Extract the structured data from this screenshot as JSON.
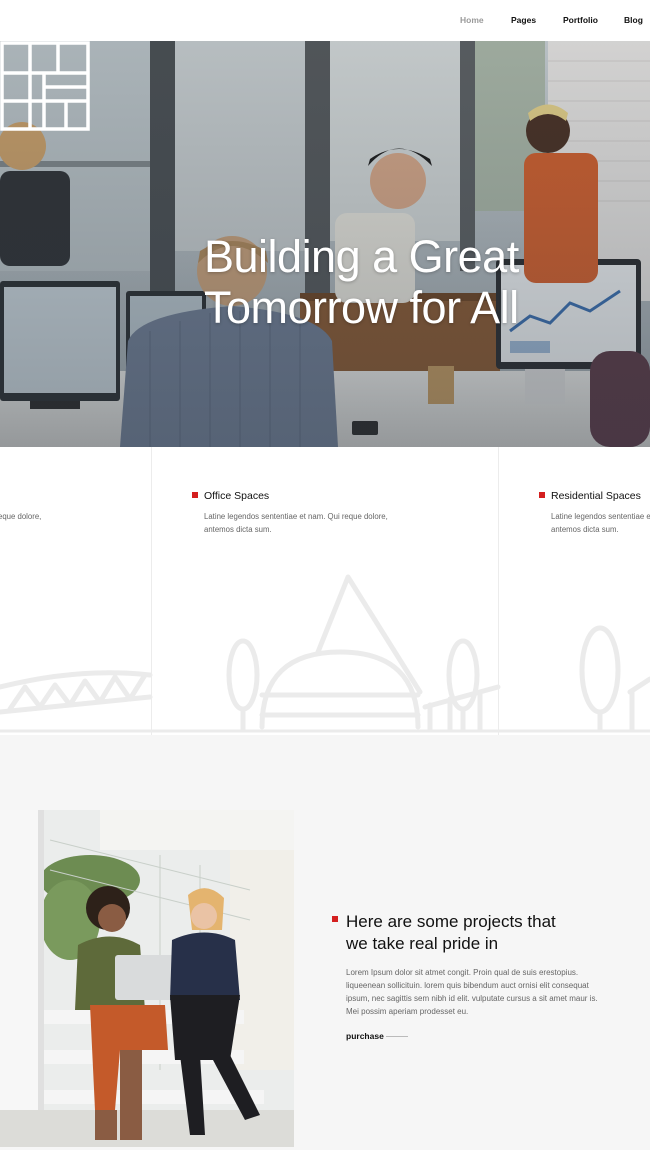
{
  "nav": {
    "items": [
      {
        "label": "Home",
        "active": true
      },
      {
        "label": "Pages",
        "active": false
      },
      {
        "label": "Portfolio",
        "active": false
      },
      {
        "label": "Blog",
        "active": false
      }
    ]
  },
  "hero": {
    "title_line1": "Building a Great",
    "title_line2": "Tomorrow for All"
  },
  "services": [
    {
      "title": "",
      "text_line1": "eque dolore,",
      "text_line2": ""
    },
    {
      "title": "Office Spaces",
      "text_line1": "Latine legendos sententiae et nam. Qui reque dolore,",
      "text_line2": "antemos dicta sum."
    },
    {
      "title": "Residential Spaces",
      "text_line1": "Latine legendos sententiae e",
      "text_line2": "antemos dicta sum."
    }
  ],
  "projects": {
    "title_line1": "Here are some projects that",
    "title_line2": "we take real pride in",
    "text_lines": [
      "Lorem Ipsum dolor sit atmet congit. Proin qual de suis erestopius.",
      "liqueenean sollicituin. lorem quis bibendum auct ornisi elit consequat",
      "ipsum, nec sagittis sem nibh id elit. vulputate cursus a sit amet maur is.",
      "Mei possim aperiam prodesset eu."
    ],
    "link_label": "purchase"
  },
  "colors": {
    "accent": "#d41f1f",
    "background": "#f6f6f6"
  }
}
